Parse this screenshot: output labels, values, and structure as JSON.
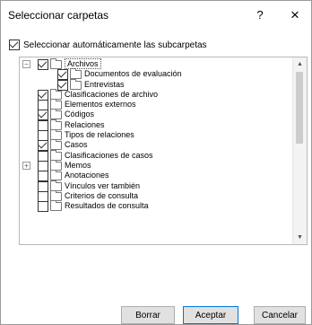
{
  "dialog": {
    "title": "Seleccionar carpetas",
    "help_label": "?",
    "close_label": "×"
  },
  "auto_subfolders": {
    "label": "Seleccionar automáticamente las subcarpetas",
    "checked": true
  },
  "tree": {
    "items": [
      {
        "label": "Archivos",
        "checked": true,
        "level": 0,
        "expander": "minus",
        "boxed": true
      },
      {
        "label": "Documentos de evaluación",
        "checked": true,
        "level": 1
      },
      {
        "label": "Entrevistas",
        "checked": true,
        "level": 1
      },
      {
        "label": "Clasificaciones de archivo",
        "checked": true,
        "level": 0
      },
      {
        "label": "Elementos externos",
        "checked": false,
        "level": 0
      },
      {
        "label": "Códigos",
        "checked": true,
        "level": 0
      },
      {
        "label": "Relaciones",
        "checked": false,
        "level": 0
      },
      {
        "label": "Tipos de relaciones",
        "checked": false,
        "level": 0
      },
      {
        "label": "Casos",
        "checked": true,
        "level": 0
      },
      {
        "label": "Clasificaciones de casos",
        "checked": false,
        "level": 0
      },
      {
        "label": "Memos",
        "checked": false,
        "level": 0,
        "expander": "plus"
      },
      {
        "label": "Anotaciones",
        "checked": false,
        "level": 0
      },
      {
        "label": "Vínculos ver también",
        "checked": false,
        "level": 0
      },
      {
        "label": "Criterios de consulta",
        "checked": false,
        "level": 0
      },
      {
        "label": "Resultados de consulta",
        "checked": false,
        "level": 0
      }
    ],
    "scroll_up_icon": "▲",
    "scroll_down_icon": "▼"
  },
  "buttons": {
    "clear": "Borrar",
    "ok": "Aceptar",
    "cancel": "Cancelar"
  }
}
